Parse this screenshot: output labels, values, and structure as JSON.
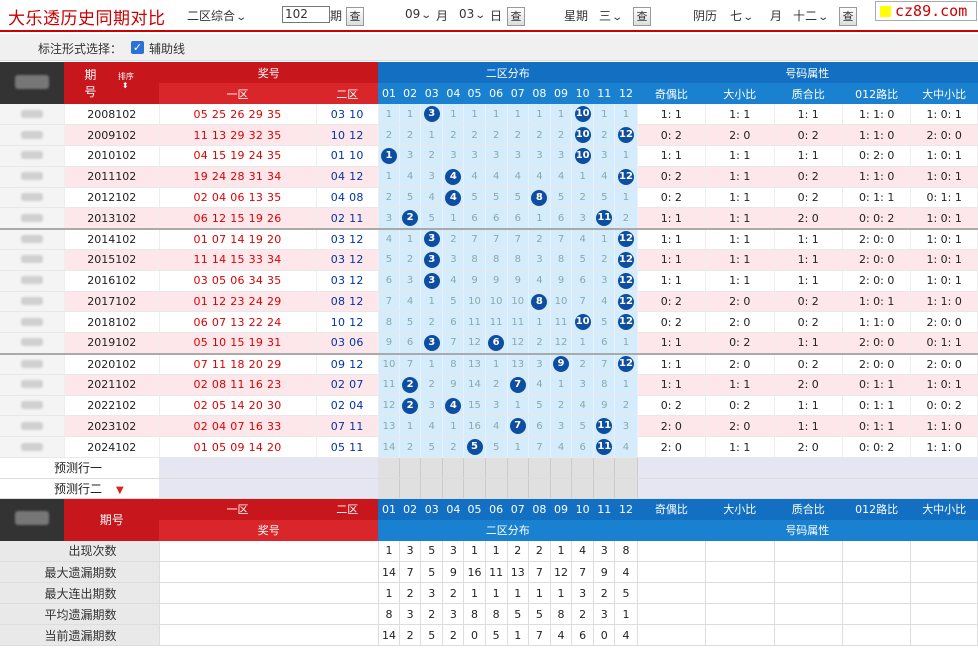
{
  "header": {
    "title": "大乐透历史同期对比",
    "zone_select": "二区综合",
    "issue_value": "102",
    "issue_suffix": "期",
    "query_label": "查",
    "month_value": "09",
    "month_label": "月",
    "day_value": "03",
    "day_label": "日",
    "week_label": "星期",
    "week_value": "三",
    "lunar_label": "阴历",
    "lunar_month": "七",
    "lunar_month_label": "月",
    "lunar_day": "十二",
    "logo_text": "cz89.com"
  },
  "options": {
    "label": "标注形式选择：",
    "checkbox_label": "辅助线",
    "checked": true
  },
  "table_header": {
    "period": "期",
    "period2": "号",
    "sort_label": "排序",
    "prize": "奖号",
    "zone1": "一区",
    "zone2": "二区",
    "dist_title": "二区分布",
    "attr_title": "号码属性",
    "dist_cols": [
      "01",
      "02",
      "03",
      "04",
      "05",
      "06",
      "07",
      "08",
      "09",
      "10",
      "11",
      "12"
    ],
    "attr_cols": [
      "奇偶比",
      "大小比",
      "质合比",
      "012路比",
      "大中小比"
    ]
  },
  "rows": [
    {
      "period": "2008102",
      "z1": "05 25 26 29 35",
      "z2": "03 10",
      "dist": [
        "1",
        "1",
        "03",
        "1",
        "1",
        "1",
        "1",
        "1",
        "1",
        "10",
        "1",
        "1"
      ],
      "attr": [
        "1: 1",
        "1: 1",
        "1: 1",
        "1: 1: 0",
        "1: 0: 1"
      ]
    },
    {
      "period": "2009102",
      "z1": "11 13 29 32 35",
      "z2": "10 12",
      "dist": [
        "2",
        "2",
        "1",
        "2",
        "2",
        "2",
        "2",
        "2",
        "2",
        "10",
        "2",
        "12"
      ],
      "attr": [
        "0: 2",
        "2: 0",
        "0: 2",
        "1: 1: 0",
        "2: 0: 0"
      ]
    },
    {
      "period": "2010102",
      "z1": "04 15 19 24 35",
      "z2": "01 10",
      "dist": [
        "01",
        "3",
        "2",
        "3",
        "3",
        "3",
        "3",
        "3",
        "3",
        "10",
        "3",
        "1"
      ],
      "attr": [
        "1: 1",
        "1: 1",
        "1: 1",
        "0: 2: 0",
        "1: 0: 1"
      ]
    },
    {
      "period": "2011102",
      "z1": "19 24 28 31 34",
      "z2": "04 12",
      "dist": [
        "1",
        "4",
        "3",
        "04",
        "4",
        "4",
        "4",
        "4",
        "4",
        "1",
        "4",
        "12"
      ],
      "attr": [
        "0: 2",
        "1: 1",
        "0: 2",
        "1: 1: 0",
        "1: 0: 1"
      ]
    },
    {
      "period": "2012102",
      "z1": "02 04 06 13 35",
      "z2": "04 08",
      "dist": [
        "2",
        "5",
        "4",
        "04",
        "5",
        "5",
        "5",
        "08",
        "5",
        "2",
        "5",
        "1"
      ],
      "attr": [
        "0: 2",
        "1: 1",
        "0: 2",
        "0: 1: 1",
        "0: 1: 1"
      ]
    },
    {
      "period": "2013102",
      "z1": "06 12 15 19 26",
      "z2": "02 11",
      "dist": [
        "3",
        "02",
        "5",
        "1",
        "6",
        "6",
        "6",
        "1",
        "6",
        "3",
        "11",
        "2"
      ],
      "attr": [
        "1: 1",
        "1: 1",
        "2: 0",
        "0: 0: 2",
        "1: 0: 1"
      ]
    },
    {
      "period": "2014102",
      "z1": "01 07 14 19 20",
      "z2": "03 12",
      "dist": [
        "4",
        "1",
        "03",
        "2",
        "7",
        "7",
        "7",
        "2",
        "7",
        "4",
        "1",
        "12"
      ],
      "attr": [
        "1: 1",
        "1: 1",
        "1: 1",
        "2: 0: 0",
        "1: 0: 1"
      ]
    },
    {
      "period": "2015102",
      "z1": "11 14 15 33 34",
      "z2": "03 12",
      "dist": [
        "5",
        "2",
        "03",
        "3",
        "8",
        "8",
        "8",
        "3",
        "8",
        "5",
        "2",
        "12"
      ],
      "attr": [
        "1: 1",
        "1: 1",
        "1: 1",
        "2: 0: 0",
        "1: 0: 1"
      ]
    },
    {
      "period": "2016102",
      "z1": "03 05 06 34 35",
      "z2": "03 12",
      "dist": [
        "6",
        "3",
        "03",
        "4",
        "9",
        "9",
        "9",
        "4",
        "9",
        "6",
        "3",
        "12"
      ],
      "attr": [
        "1: 1",
        "1: 1",
        "1: 1",
        "2: 0: 0",
        "1: 0: 1"
      ]
    },
    {
      "period": "2017102",
      "z1": "01 12 23 24 29",
      "z2": "08 12",
      "dist": [
        "7",
        "4",
        "1",
        "5",
        "10",
        "10",
        "10",
        "08",
        "10",
        "7",
        "4",
        "12"
      ],
      "attr": [
        "0: 2",
        "2: 0",
        "0: 2",
        "1: 0: 1",
        "1: 1: 0"
      ]
    },
    {
      "period": "2018102",
      "z1": "06 07 13 22 24",
      "z2": "10 12",
      "dist": [
        "8",
        "5",
        "2",
        "6",
        "11",
        "11",
        "11",
        "1",
        "11",
        "10",
        "5",
        "12"
      ],
      "attr": [
        "0: 2",
        "2: 0",
        "0: 2",
        "1: 1: 0",
        "2: 0: 0"
      ]
    },
    {
      "period": "2019102",
      "z1": "05 10 15 19 31",
      "z2": "03 06",
      "dist": [
        "9",
        "6",
        "03",
        "7",
        "12",
        "06",
        "12",
        "2",
        "12",
        "1",
        "6",
        "1"
      ],
      "attr": [
        "1: 1",
        "0: 2",
        "1: 1",
        "2: 0: 0",
        "0: 1: 1"
      ]
    },
    {
      "period": "2020102",
      "z1": "07 11 18 20 29",
      "z2": "09 12",
      "dist": [
        "10",
        "7",
        "1",
        "8",
        "13",
        "1",
        "13",
        "3",
        "09",
        "2",
        "7",
        "12"
      ],
      "attr": [
        "1: 1",
        "2: 0",
        "0: 2",
        "2: 0: 0",
        "2: 0: 0"
      ]
    },
    {
      "period": "2021102",
      "z1": "02 08 11 16 23",
      "z2": "02 07",
      "dist": [
        "11",
        "02",
        "2",
        "9",
        "14",
        "2",
        "07",
        "4",
        "1",
        "3",
        "8",
        "1"
      ],
      "attr": [
        "1: 1",
        "1: 1",
        "2: 0",
        "0: 1: 1",
        "1: 0: 1"
      ]
    },
    {
      "period": "2022102",
      "z1": "02 05 14 20 30",
      "z2": "02 04",
      "dist": [
        "12",
        "02",
        "3",
        "04",
        "15",
        "3",
        "1",
        "5",
        "2",
        "4",
        "9",
        "2"
      ],
      "attr": [
        "0: 2",
        "0: 2",
        "1: 1",
        "0: 1: 1",
        "0: 0: 2"
      ]
    },
    {
      "period": "2023102",
      "z1": "02 04 07 16 33",
      "z2": "07 11",
      "dist": [
        "13",
        "1",
        "4",
        "1",
        "16",
        "4",
        "07",
        "6",
        "3",
        "5",
        "11",
        "3"
      ],
      "attr": [
        "2: 0",
        "2: 0",
        "1: 1",
        "0: 1: 1",
        "1: 1: 0"
      ]
    },
    {
      "period": "2024102",
      "z1": "01 05 09 14 20",
      "z2": "05 11",
      "dist": [
        "14",
        "2",
        "5",
        "2",
        "05",
        "5",
        "1",
        "7",
        "4",
        "6",
        "11",
        "4"
      ],
      "attr": [
        "2: 0",
        "1: 1",
        "2: 0",
        "0: 0: 2",
        "1: 1: 0"
      ]
    }
  ],
  "predict": {
    "row1": "预测行一",
    "row2": "预测行二"
  },
  "footer_header": {
    "period": "期号",
    "zone1": "一区",
    "zone2": "二区",
    "prize": "奖号",
    "dist_title": "二区分布",
    "attr_title": "号码属性"
  },
  "stats": [
    {
      "label": "出现次数",
      "values": [
        "1",
        "3",
        "5",
        "3",
        "1",
        "1",
        "2",
        "2",
        "1",
        "4",
        "3",
        "8"
      ]
    },
    {
      "label": "最大遗漏期数",
      "values": [
        "14",
        "7",
        "5",
        "9",
        "16",
        "11",
        "13",
        "7",
        "12",
        "7",
        "9",
        "4"
      ]
    },
    {
      "label": "最大连出期数",
      "values": [
        "1",
        "2",
        "3",
        "2",
        "1",
        "1",
        "1",
        "1",
        "1",
        "3",
        "2",
        "5"
      ]
    },
    {
      "label": "平均遗漏期数",
      "values": [
        "8",
        "3",
        "2",
        "3",
        "8",
        "8",
        "5",
        "5",
        "8",
        "2",
        "3",
        "1"
      ]
    },
    {
      "label": "当前遗漏期数",
      "values": [
        "14",
        "2",
        "5",
        "2",
        "0",
        "5",
        "1",
        "7",
        "4",
        "6",
        "0",
        "4"
      ]
    }
  ]
}
